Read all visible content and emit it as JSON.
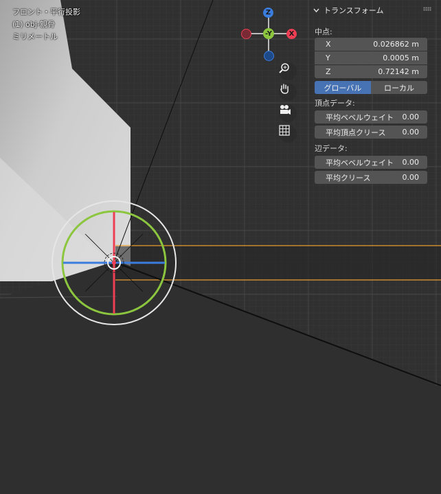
{
  "viewport": {
    "view_name": "フロント・平行投影",
    "object_info": "(1) obj-親骨",
    "units": "ミリメートル"
  },
  "gizmo": {
    "z_label": "Z",
    "y_label": "-Y",
    "x_label": "X"
  },
  "navigation": {
    "zoom_icon": "zoom-icon",
    "pan_icon": "hand-icon",
    "camera_icon": "camera-icon",
    "ortho_icon": "grid-icon"
  },
  "colors": {
    "accent": "#4772b3",
    "x_axis": "#ee3e54",
    "y_axis": "#8cc63f",
    "z_axis": "#3b7ddd",
    "selection_edge": "#e69a2d"
  },
  "panel": {
    "title": "トランスフォーム",
    "median_label": "中点:",
    "median": [
      {
        "axis": "X",
        "value": "0.026862 m"
      },
      {
        "axis": "Y",
        "value": "0.0005 m"
      },
      {
        "axis": "Z",
        "value": "0.72142 m"
      }
    ],
    "space_global": "グローバル",
    "space_local": "ローカル",
    "vertex_data_label": "頂点データ:",
    "vertex_fields": [
      {
        "label": "平均ベベルウェイト",
        "value": "0.00"
      },
      {
        "label": "平均頂点クリース",
        "value": "0.00"
      }
    ],
    "edge_data_label": "辺データ:",
    "edge_fields": [
      {
        "label": "平均ベベルウェイト",
        "value": "0.00"
      },
      {
        "label": "平均クリース",
        "value": "0.00"
      }
    ]
  }
}
